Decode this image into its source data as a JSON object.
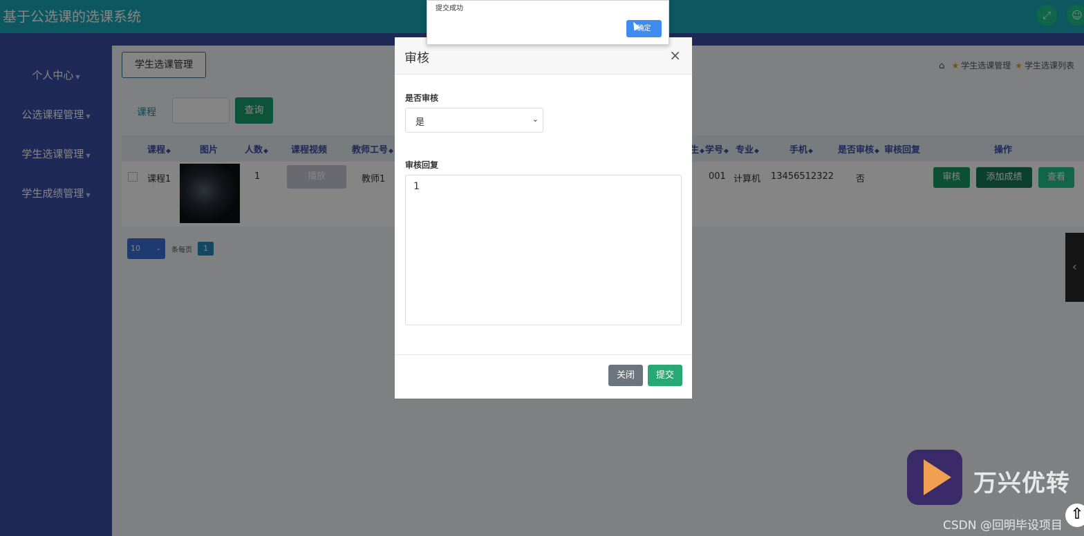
{
  "app": {
    "title": "基于公选课的选课系统",
    "fullscreen_icon": "expand-icon",
    "user_icon": "user-icon"
  },
  "sidebar": {
    "items": [
      {
        "label": "个人中心"
      },
      {
        "label": "公选课程管理"
      },
      {
        "label": "学生选课管理"
      },
      {
        "label": "学生成绩管理"
      }
    ]
  },
  "page": {
    "tab": "学生选课管理",
    "breadcrumb": [
      "学生选课管理",
      "学生选课列表"
    ]
  },
  "search": {
    "label": "课程",
    "value": "",
    "button": "查询"
  },
  "table": {
    "headers": [
      "课程",
      "图片",
      "人数",
      "课程视频",
      "教师工号",
      "学号",
      "专业",
      "手机",
      "是否审核",
      "审核回复",
      "操作"
    ],
    "header_partial": "生",
    "row": {
      "course": "课程1",
      "count": "1",
      "video_button": "播放",
      "teacher_id": "教师1",
      "student_id": "001",
      "major": "计算机",
      "phone": "13456512322",
      "audited": "否"
    },
    "actions": [
      "审核",
      "添加成绩",
      "查看"
    ]
  },
  "pagination": {
    "page_size": "10",
    "per_page_label": "条每页",
    "current_page": "1"
  },
  "modal": {
    "title": "审核",
    "close_symbol": "×",
    "audit_label": "是否审核",
    "audit_value": "是",
    "reply_label": "审核回复",
    "reply_value": "1",
    "close_button": "关闭",
    "submit_button": "提交"
  },
  "alert": {
    "message": "提交成功",
    "ok_button": "确定"
  },
  "watermark": {
    "brand": "万兴优转",
    "csdn": "CSDN @回明毕设项目"
  },
  "colors": {
    "topbar": "#1aa9b8",
    "sidebar": "#3b4fa8",
    "primary_green": "#1aa06e",
    "submit_green": "#28a876",
    "close_gray": "#6c757d",
    "alert_blue": "#3f8cf0"
  }
}
